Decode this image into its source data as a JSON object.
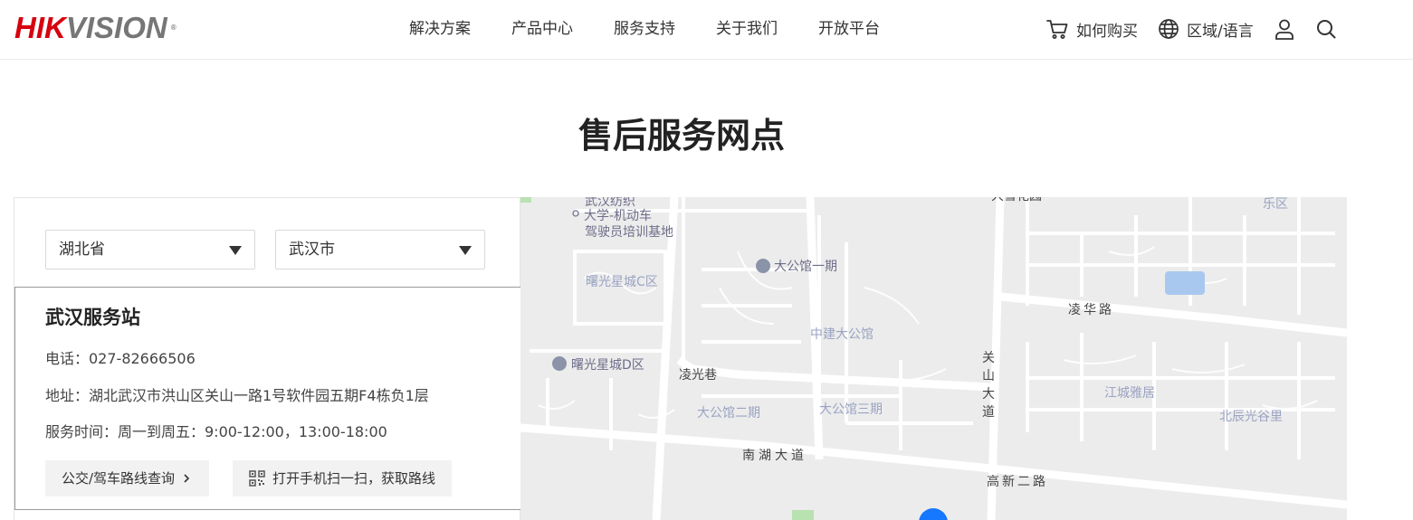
{
  "brand": {
    "logo_red": "HIK",
    "logo_gray": "VISION",
    "logo_mark": "®"
  },
  "nav": {
    "items": [
      {
        "label": "解决方案"
      },
      {
        "label": "产品中心"
      },
      {
        "label": "服务支持"
      },
      {
        "label": "关于我们"
      },
      {
        "label": "开放平台"
      }
    ]
  },
  "header_right": {
    "buy_label": "如何购买",
    "region_label": "区域/语言",
    "icons": [
      "cart-icon",
      "globe-icon",
      "user-icon",
      "search-icon"
    ]
  },
  "page": {
    "title": "售后服务网点"
  },
  "filters": {
    "province": "湖北省",
    "city": "武汉市"
  },
  "station": {
    "name": "武汉服务站",
    "phone": "电话：027-82666506",
    "address": "地址：湖北武汉市洪山区关山一路1号软件园五期F4栋负1层",
    "hours": "服务时间：周一到周五：9:00-12:00，13:00-18:00",
    "route_button": "公交/驾车路线查询",
    "qr_button": "打开手机扫一扫，获取路线"
  },
  "map": {
    "labels": {
      "l1": "武汉纺织",
      "l2": "大学-机动车",
      "l3": "驾驶员培训基地",
      "l4": "大公馆一期",
      "l5": "曙光星城C区",
      "l6": "中建大公馆",
      "l7": "曙光星城D区",
      "l8": "凌光巷",
      "l9": "大公馆二期",
      "l10": "大公馆三期",
      "l11": "南湖大道",
      "l12": "凌华路",
      "l13": "关山大道",
      "l14": "江城雅居",
      "l15": "北辰光谷里",
      "l16": "高新二路",
      "l17": "乐区",
      "l18": "大雪花园"
    },
    "marker_color": "#1677ff",
    "water_color": "#a9c8f0",
    "green_color": "#b8e2b0"
  }
}
